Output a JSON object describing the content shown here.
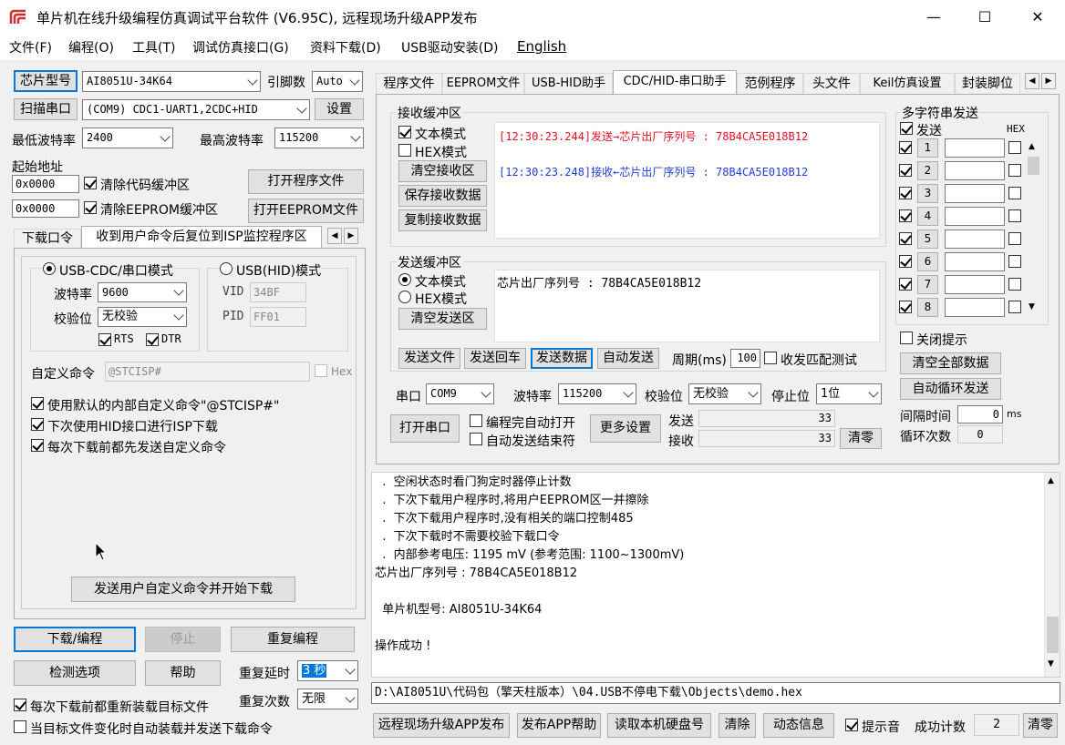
{
  "window": {
    "title": "单片机在线升级编程仿真调试平台软件 (V6.95C), 远程现场升级APP发布",
    "minimize_glyph": "—",
    "maximize_glyph": "☐",
    "close_glyph": "✕"
  },
  "menu": [
    "文件(F)",
    "编程(O)",
    "工具(T)",
    "调试仿真接口(G)",
    "资料下载(D)",
    "USB驱动安装(D)",
    "English"
  ],
  "left": {
    "chip_type_btn": "芯片型号",
    "chip_type": "AI8051U-34K64",
    "pin_count_label": "引脚数",
    "pin_count": "Auto",
    "scan_port_btn": "扫描串口",
    "port": "(COM9) CDC1-UART1,2CDC+HID",
    "settings_btn": "设置",
    "min_baud_label": "最低波特率",
    "min_baud": "2400",
    "max_baud_label": "最高波特率",
    "max_baud": "115200",
    "start_addr_label": "起始地址",
    "addr1": "0x0000",
    "clear_code_buf": "清除代码缓冲区",
    "open_program_btn": "打开程序文件",
    "addr2": "0x0000",
    "clear_eeprom_buf": "清除EEPROM缓冲区",
    "open_eeprom_btn": "打开EEPROM文件",
    "tabs": [
      "下载口令",
      "收到用户命令后复位到ISP监控程序区"
    ],
    "mode_cdc": "USB-CDC/串口模式",
    "mode_hid": "USB(HID)模式",
    "baud_label": "波特率",
    "baud": "9600",
    "parity_label": "校验位",
    "parity": "无校验",
    "rts": "RTS",
    "dtr": "DTR",
    "vid_label": "VID",
    "vid": "34BF",
    "pid_label": "PID",
    "pid": "FF01",
    "custom_cmd_label": "自定义命令",
    "custom_cmd": "@STCISP#",
    "hex_label": "Hex",
    "opt1": "使用默认的内部自定义命令\"@STCISP#\"",
    "opt2": "下次使用HID接口进行ISP下载",
    "opt3": "每次下载前都先发送自定义命令",
    "send_custom_btn": "发送用户自定义命令并开始下载",
    "download_btn": "下载/编程",
    "stop_btn": "停止",
    "reprogram_btn": "重复编程",
    "detect_btn": "检测选项",
    "help_btn": "帮助",
    "repeat_delay_label": "重复延时",
    "repeat_delay": "3 秒",
    "repeat_count_label": "重复次数",
    "repeat_count": "无限",
    "reload_each": "每次下载前都重新装载目标文件",
    "auto_reload": "当目标文件变化时自动装载并发送下载命令"
  },
  "right": {
    "tabs": [
      "程序文件",
      "EEPROM文件",
      "USB-HID助手",
      "CDC/HID-串口助手",
      "范例程序",
      "头文件",
      "Keil仿真设置",
      "封装脚位"
    ],
    "recv_group": "接收缓冲区",
    "recv_text_mode": "文本模式",
    "recv_hex_mode": "HEX模式",
    "clear_recv_btn": "清空接收区",
    "save_recv_btn": "保存接收数据",
    "copy_recv_btn": "复制接收数据",
    "recv_line1": "[12:30:23.244]发送→芯片出厂序列号 : 78B4CA5E018B12",
    "recv_line2": "[12:30:23.248]接收←芯片出厂序列号 : 78B4CA5E018B12",
    "recv_line1_color": "#e81123",
    "recv_line2_color": "#1f3fd6",
    "send_group": "发送缓冲区",
    "send_text_mode": "文本模式",
    "send_hex_mode": "HEX模式",
    "clear_send_btn": "清空发送区",
    "send_content": "芯片出厂序列号 : 78B4CA5E018B12",
    "send_file_btn": "发送文件",
    "send_cr_btn": "发送回车",
    "send_data_btn": "发送数据",
    "auto_send_btn": "自动发送",
    "period_label": "周期(ms)",
    "period": "100",
    "match_test": "收发匹配测试",
    "port_label": "串口",
    "port": "COM9",
    "baud_label": "波特率",
    "baud": "115200",
    "parity_label": "校验位",
    "parity": "无校验",
    "stopbit_label": "停止位",
    "stopbit": "1位",
    "open_port_btn": "打开串口",
    "auto_open": "编程完自动打开",
    "auto_send_end": "自动发送结束符",
    "more_settings_btn": "更多设置",
    "sent_label": "发送",
    "sent_count": "33",
    "recv_label": "接收",
    "recv_count": "33",
    "clear_counts_btn": "清零",
    "multi_group": "多字符串发送",
    "multi_send": "发送",
    "multi_hex": "HEX",
    "multi_rows": [
      "1",
      "2",
      "3",
      "4",
      "5",
      "6",
      "7",
      "8"
    ],
    "close_tip": "关闭提示",
    "clear_all_btn": "清空全部数据",
    "auto_loop_btn": "自动循环发送",
    "interval_label": "间隔时间",
    "interval": "0",
    "interval_unit": "ms",
    "loop_count_label": "循环次数",
    "loop_count": "0"
  },
  "log": {
    "lines": [
      "  .  空闲状态时看门狗定时器停止计数",
      "  .  下次下载用户程序时,将用户EEPROM区一并擦除",
      "  .  下次下载用户程序时,没有相关的端口控制485",
      "  .  下次下载时不需要校验下载口令",
      "  .  内部参考电压: 1195 mV (参考范围: 1100~1300mV)",
      "芯片出厂序列号 : 78B4CA5E018B12",
      "",
      "  单片机型号: AI8051U-34K64",
      "",
      "操作成功 !"
    ],
    "file_path": "D:\\AI8051U\\代码包（擎天柱版本）\\04.USB不停电下载\\Objects\\demo.hex"
  },
  "bottom": {
    "remote_btn": "远程现场升级APP发布",
    "app_help_btn": "发布APP帮助",
    "read_disk_btn": "读取本机硬盘号",
    "clear_btn": "清除",
    "dyn_info_btn": "动态信息",
    "beep": "提示音",
    "success_count_label": "成功计数",
    "success_count": "2",
    "clear_count_btn": "清零"
  }
}
